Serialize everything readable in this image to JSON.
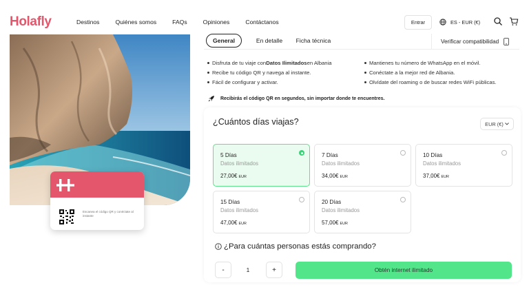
{
  "brand": {
    "logo_text": "Holafly",
    "accent": "#e4566c",
    "green": "#52e58a"
  },
  "nav": {
    "items": [
      "Destinos",
      "Quiénes somos",
      "FAQs",
      "Opiniones",
      "Contáctanos"
    ]
  },
  "header": {
    "login_label": "Entrar",
    "lang_currency": "ES - EUR (€)",
    "icons": [
      "globe-icon",
      "search-icon",
      "cart-icon"
    ]
  },
  "card": {
    "text": "Escanea el código QR y conéctate al instante"
  },
  "tabs": {
    "items": [
      "General",
      "En detalle",
      "Ficha técnica"
    ],
    "active": "General"
  },
  "verify": {
    "label": "Verificar compatibilidad"
  },
  "features": {
    "left_1_pre": "Disfruta de tu viaje con ",
    "left_1_bold": "Datos Ilimitados",
    "left_1_post": " en Albania",
    "left_2": "Recibe tu código QR y navega al instante.",
    "left_3": "Fácil de configurar y activar.",
    "right_1": "Mantienes tu número de WhatsApp en el móvil.",
    "right_2": "Conéctate a la mejor red de Albania.",
    "right_3": "Olvídate del roaming o de buscar redes WiFi públicas."
  },
  "qr_note": "Recibirás el código QR en segundos, sin importar donde te encuentres.",
  "plans": {
    "question": "¿Cuántos días viajas?",
    "currency_select": "EUR (€)",
    "items": [
      {
        "title": "5 Días",
        "subtitle": "Datos ilimitados",
        "price": "27,00€",
        "currency": "EUR",
        "selected": true
      },
      {
        "title": "7 Días",
        "subtitle": "Datos ilimitados",
        "price": "34,00€",
        "currency": "EUR",
        "selected": false
      },
      {
        "title": "10 Días",
        "subtitle": "Datos ilimitados",
        "price": "37,00€",
        "currency": "EUR",
        "selected": false
      },
      {
        "title": "15 Días",
        "subtitle": "Datos ilimitados",
        "price": "47,00€",
        "currency": "EUR",
        "selected": false
      },
      {
        "title": "20 Días",
        "subtitle": "Datos ilimitados",
        "price": "57,00€",
        "currency": "EUR",
        "selected": false
      }
    ]
  },
  "people": {
    "question": "¿Para cuántas personas estás comprando?",
    "minus": "-",
    "quantity": "1",
    "plus": "+",
    "cta": "Obtén internet ilimitado"
  }
}
